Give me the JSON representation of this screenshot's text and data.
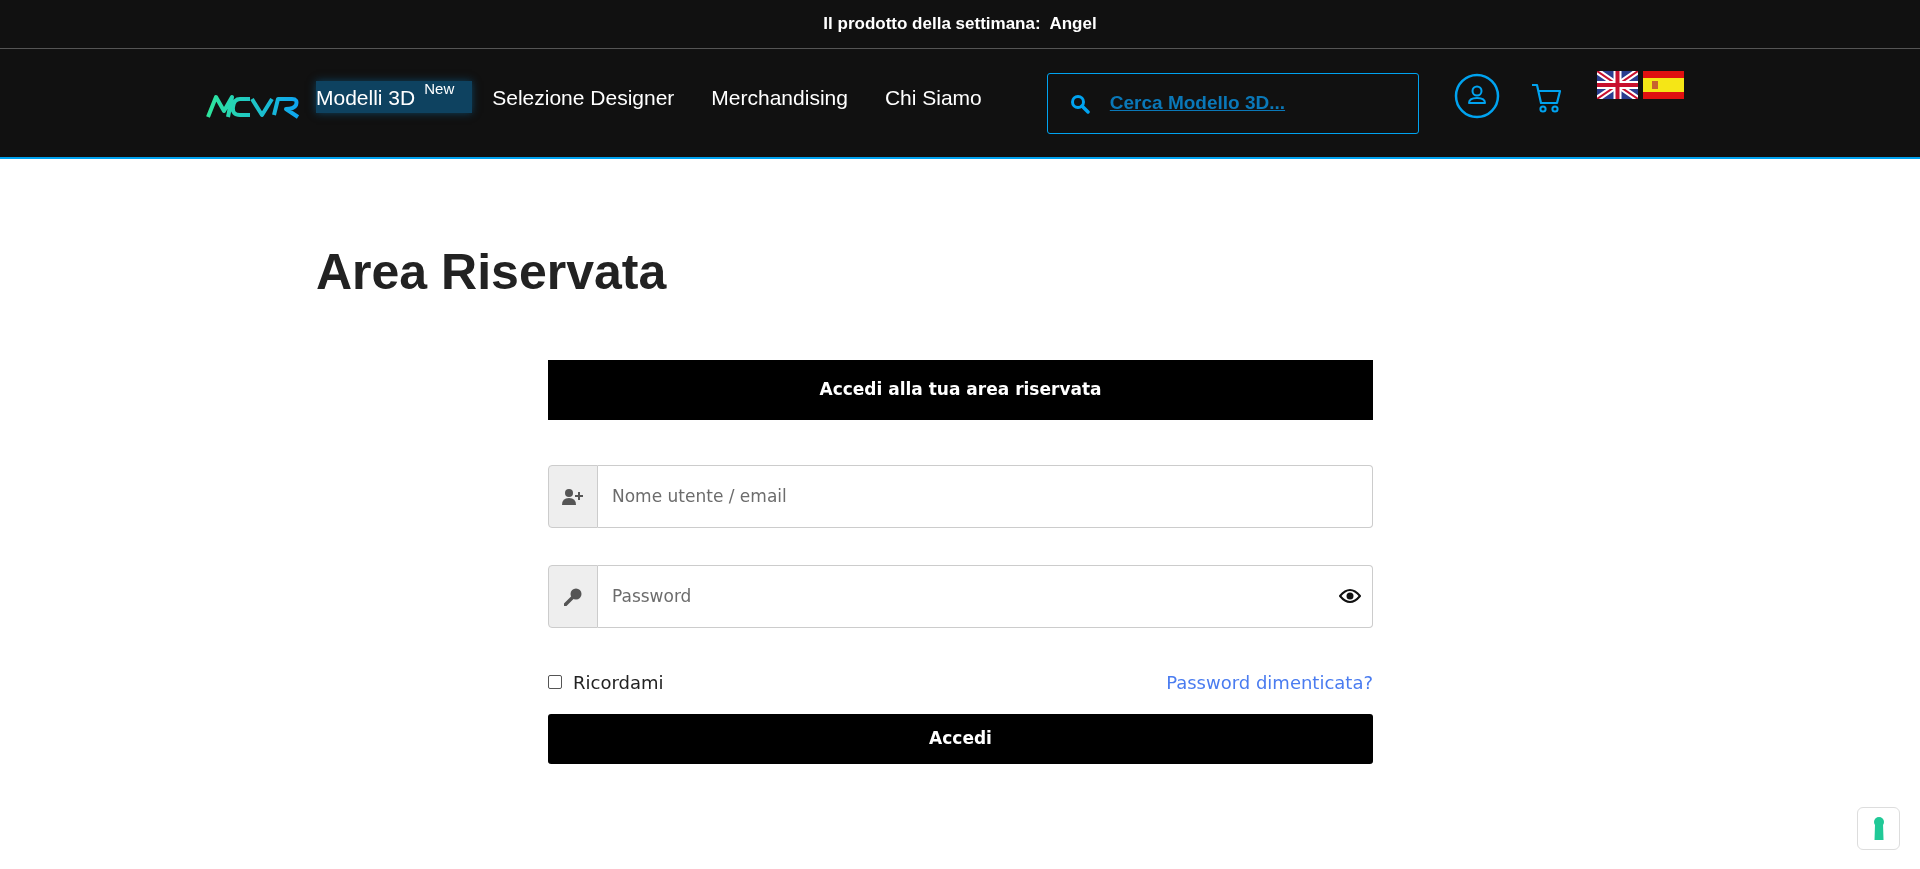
{
  "announcement": {
    "label": "Il prodotto della settimana:",
    "product": "Angel"
  },
  "nav": {
    "items": [
      {
        "label": "Modelli 3D",
        "badge": "New",
        "selected": true
      },
      {
        "label": "Selezione Designer",
        "selected": false
      },
      {
        "label": "Merchandising",
        "selected": false
      },
      {
        "label": "Chi Siamo",
        "selected": false
      }
    ],
    "search": {
      "placeholder": "Cerca Modello 3D..."
    }
  },
  "page_title": "Area Riservata",
  "login": {
    "header": "Accedi alla tua area riservata",
    "fields": [
      {
        "kind": "user",
        "placeholder": "Nome utente / email"
      },
      {
        "kind": "password",
        "placeholder": "Password"
      }
    ],
    "remember": {
      "label": "Ricordami",
      "checked": false
    },
    "forgot_link": "Password dimenticata?",
    "submit": "Accedi"
  }
}
